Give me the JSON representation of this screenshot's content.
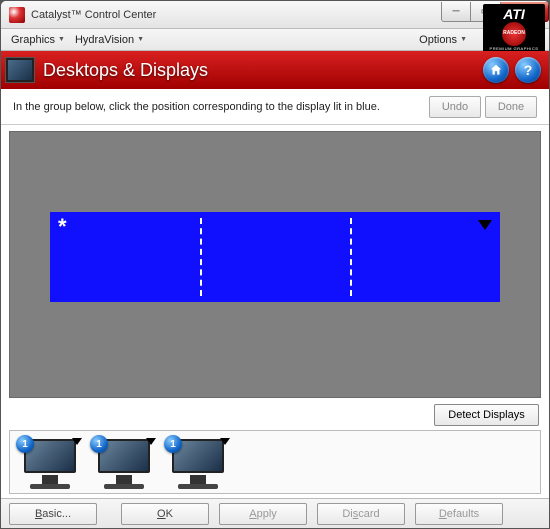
{
  "window": {
    "title": "Catalyst™ Control Center"
  },
  "menubar": {
    "graphics": "Graphics",
    "hydravision": "HydraVision",
    "options": "Options"
  },
  "brand": {
    "ati": "ATI",
    "radeon": "RADEON",
    "premium": "PREMIUM GRAPHICS"
  },
  "header": {
    "heading": "Desktops & Displays"
  },
  "instruction": {
    "text": "In the group below, click the position corresponding to the display lit in blue.",
    "undo": "Undo",
    "done": "Done"
  },
  "stage": {
    "asterisk": "*"
  },
  "detect": {
    "label": "Detect Displays"
  },
  "thumbs": [
    {
      "badge": "1"
    },
    {
      "badge": "1"
    },
    {
      "badge": "1"
    }
  ],
  "footer": {
    "basic": "Basic...",
    "ok": "OK",
    "apply": "Apply",
    "discard": "Discard",
    "defaults": "Defaults"
  }
}
